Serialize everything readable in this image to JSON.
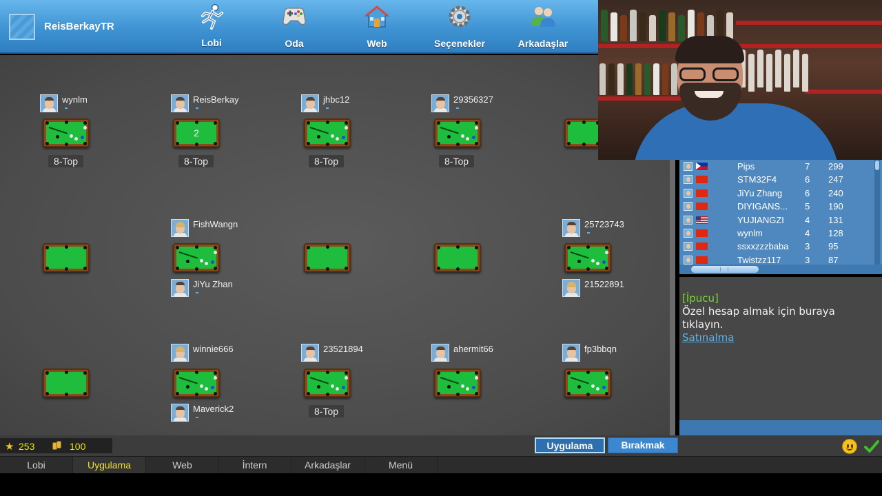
{
  "header": {
    "username": "ReisBerkayTR",
    "nav": [
      {
        "label": "Lobi",
        "icon": "running-man-icon"
      },
      {
        "label": "Oda",
        "icon": "gamepad-icon"
      },
      {
        "label": "Web",
        "icon": "house-icon"
      },
      {
        "label": "Seçenekler",
        "icon": "gear-icon"
      },
      {
        "label": "Arkadaşlar",
        "icon": "friends-icon"
      }
    ]
  },
  "lobby": {
    "players": {
      "p1": "wynlm",
      "p2": "ReisBerkay",
      "p3": "jhbc12",
      "p4": "29356327",
      "p5": "FishWangn",
      "p6": "JiYu Zhan",
      "p7": "25723743",
      "p8": "21522891",
      "p9": "winnie666",
      "p10": "Maverick2",
      "p11": "23521894",
      "p12": "ahermit66",
      "p13": "fp3bbqn"
    },
    "table_label": "8-Top",
    "table_number": "2"
  },
  "leaderboard": {
    "rows": [
      {
        "name": "Pips",
        "level": "7",
        "points": "299",
        "flag": "philippines"
      },
      {
        "name": "STM32F4",
        "level": "6",
        "points": "247",
        "flag": "china"
      },
      {
        "name": "JiYu Zhang",
        "level": "6",
        "points": "240",
        "flag": "china"
      },
      {
        "name": "DIYIGANS...",
        "level": "5",
        "points": "190",
        "flag": "china"
      },
      {
        "name": "YUJIANGZI",
        "level": "4",
        "points": "131",
        "flag": "usa"
      },
      {
        "name": "wynlm",
        "level": "4",
        "points": "128",
        "flag": "china"
      },
      {
        "name": "ssxxzzzbaba",
        "level": "3",
        "points": "95",
        "flag": "china"
      },
      {
        "name": "Twistzz117",
        "level": "3",
        "points": "87",
        "flag": "china"
      }
    ]
  },
  "chat": {
    "tip_tag": "[İpucu]",
    "tip_text": "Özel hesap almak için buraya tıklayın.",
    "link": "Satınalma"
  },
  "currency": {
    "stars": "253",
    "coins": "100"
  },
  "buttons": {
    "apply": "Uygulama",
    "leave": "Bırakmak"
  },
  "tabs": [
    "Lobi",
    "Uygulama",
    "Web",
    "İntern",
    "Arkadaşlar",
    "Menü"
  ],
  "colors": {
    "header": "#3f93d3",
    "felt": "#1fbd3d",
    "rail": "#8a4a1a",
    "active_tab": "#f1e02a",
    "accent": "#2f6fb0"
  }
}
